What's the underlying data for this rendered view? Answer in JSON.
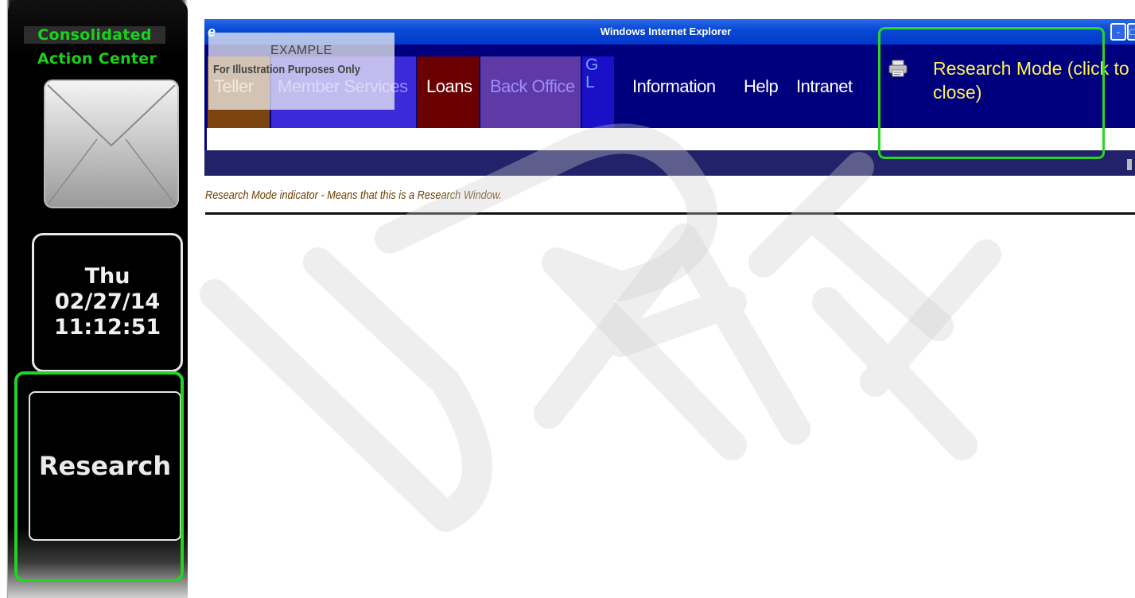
{
  "action_center": {
    "title_line1": "Consolidated",
    "title_line2": "Action Center",
    "envelope_icon": "envelope-icon",
    "clock": {
      "day": "Thu",
      "date": "02/27/14",
      "time": "11:12:51"
    },
    "research_button": "Research"
  },
  "browser": {
    "title": "Windows Internet Explorer",
    "nav": {
      "teller": "Teller",
      "member_services": "Member Services",
      "loans": "Loans",
      "back_office": "Back Office",
      "gl_top": "G",
      "gl_bottom": "L",
      "information": "Information",
      "help": "Help",
      "intranet": "Intranet"
    },
    "research_mode": "Research Mode (click to close)",
    "printer_icon": "printer-icon"
  },
  "overlay": {
    "title": "EXAMPLE",
    "subtitle": "For Illustration Purposes Only"
  },
  "caption": "Research Mode indicator - Means that this is a Research Window.",
  "colors": {
    "highlight": "#22d422",
    "nav_bg": "#00007e",
    "research_mode_text": "#ffef55",
    "ac_title": "#19d21b"
  }
}
